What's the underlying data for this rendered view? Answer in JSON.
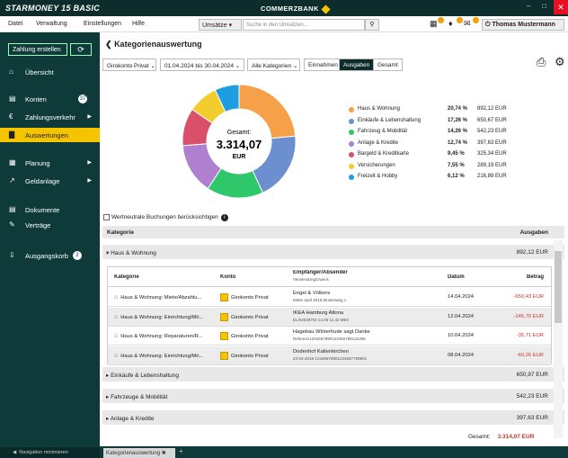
{
  "app": {
    "brand": "STARMONEY 15 BASIC",
    "bank": "COMMERZBANK"
  },
  "menu": [
    "Datei",
    "Verwaltung",
    "Einstellungen",
    "Hilfe"
  ],
  "search": {
    "scope": "Umsätze",
    "placeholder": "Suche in den Umsätzen..."
  },
  "user": "Thomas Mustermann",
  "sidebar": {
    "create_button": "Zahlung erstellen",
    "items": [
      {
        "label": "Übersicht",
        "icon": "home-icon"
      },
      {
        "label": "Konten",
        "icon": "list-icon",
        "count": "37"
      },
      {
        "label": "Zahlungsverkehr",
        "icon": "euro-icon"
      },
      {
        "label": "Auswertungen",
        "icon": "bar-chart-icon"
      },
      {
        "label": "Planung",
        "icon": "calendar-icon"
      },
      {
        "label": "Geldanlage",
        "icon": "growth-icon"
      },
      {
        "label": "Dokumente",
        "icon": "document-icon"
      },
      {
        "label": "Verträge",
        "icon": "contract-icon"
      },
      {
        "label": "Ausgangskorb",
        "icon": "outbox-icon",
        "count": "2"
      }
    ],
    "footer": "Navigation minimieren"
  },
  "page": {
    "title": "Kategorienauswertung",
    "account_filter": "Girokonto Privat",
    "date_filter": "01.04.2024 bis 30.04.2024",
    "category_filter": "Alle Kategorien",
    "toggle": [
      "Einnahmen",
      "Ausgaben",
      "Gesamt"
    ],
    "checkbox_label": "Wertneutrale Buchungen berücksichtigen"
  },
  "chart_data": {
    "type": "pie",
    "center_label": "Gesamt:",
    "center_value": "3.314,07",
    "center_unit": "EUR",
    "slices": [
      {
        "label": "Haus & Wohnung",
        "percent": 20.74,
        "pct_text": "20,74 %",
        "amount": "892,12 EUR",
        "color": "#f6a04a"
      },
      {
        "label": "Einkäufe & Lebenshaltung",
        "percent": 17.26,
        "pct_text": "17,26 %",
        "amount": "650,67 EUR",
        "color": "#6b8fcf"
      },
      {
        "label": "Fahrzeug & Mobilität",
        "percent": 14.26,
        "pct_text": "14,26 %",
        "amount": "542,23 EUR",
        "color": "#2ec76a"
      },
      {
        "label": "Anlage & Kredite",
        "percent": 12.74,
        "pct_text": "12,74 %",
        "amount": "397,63 EUR",
        "color": "#b07fcf"
      },
      {
        "label": "Bargeld & Kreditkarte",
        "percent": 9.45,
        "pct_text": "9,45 %",
        "amount": "325,34 EUR",
        "color": "#d9506a"
      },
      {
        "label": "Versicherungen",
        "percent": 7.55,
        "pct_text": "7,55 %",
        "amount": "289,19 EUR",
        "color": "#f3cc2e"
      },
      {
        "label": "Freizeit & Hobby",
        "percent": 6.12,
        "pct_text": "6,12 %",
        "amount": "216,89 EUR",
        "color": "#1e9ee0"
      }
    ]
  },
  "table": {
    "col_category": "Kategorie",
    "col_expenses": "Ausgaben",
    "groups": [
      {
        "label": "Haus & Wohnung",
        "amount": "892,12 EUR",
        "expanded": true
      },
      {
        "label": "Einkäufe & Lebenshaltung",
        "amount": "650,97 EUR"
      },
      {
        "label": "Fahrzeuge & Mobilität",
        "amount": "542,23 EUR"
      },
      {
        "label": "Anlage & Kredite",
        "amount": "397,63 EUR"
      }
    ],
    "sub_headers": {
      "category": "Kategorie",
      "account": "Konto",
      "payee": "Empfänger/Absender",
      "purpose": "Verwendungszweck",
      "date": "Datum",
      "amount": "Betrag"
    },
    "rows": [
      {
        "category": "Haus & Wohnung: Miete/Abzahlu...",
        "account": "Girokonto Privat",
        "payee": "Engel & Völkers",
        "purpose": "Miete April 2018 Musterweg 1",
        "date": "14.04.2024",
        "amount": "-650,43 EUR"
      },
      {
        "category": "Haus & Wohnung: Einrichtung/Mö...",
        "account": "Girokonto Privat",
        "payee": "IKEA Hamburg Altona",
        "purpose": "EL/54048702 14.06 11.42 ME0",
        "date": "12.04.2024",
        "amount": "-145,70 EUR"
      },
      {
        "category": "Haus & Wohnung: Reparaturen/R...",
        "account": "Girokonto Privat",
        "payee": "Hagebau Winterhude sagt Danke",
        "purpose": "Referenz1234567890123456789123456",
        "date": "10.04.2024",
        "amount": "-35,71 EUR"
      },
      {
        "category": "Haus & Wohnung: Einrichtung/Mö...",
        "account": "Girokonto Privat",
        "payee": "Dodenhof Kaltenkirchen",
        "purpose": "23-04-2018-12345678901234567789901",
        "date": "08.04.2024",
        "amount": "-60,26 EUR"
      }
    ],
    "total_label": "Gesamt:",
    "total_value": "3.314,07 EUR"
  },
  "tabbar": {
    "tab": "Kategorienauswertung",
    "add": "+"
  }
}
